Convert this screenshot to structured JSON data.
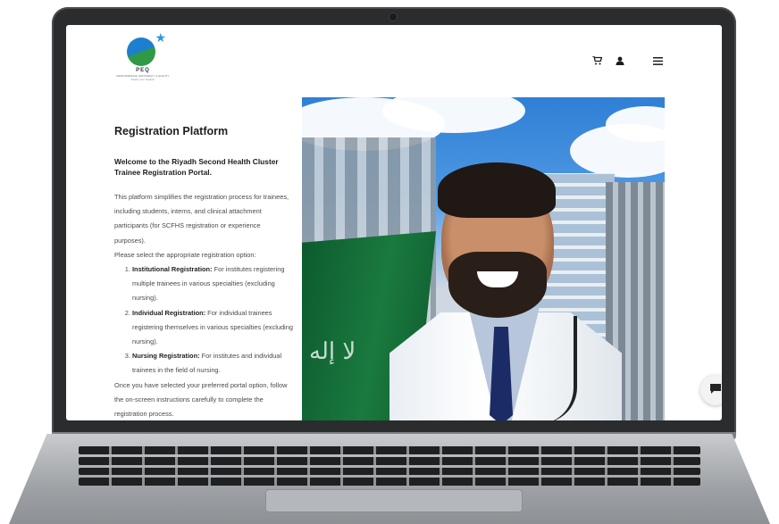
{
  "header": {
    "logo_abbr": "PEQ",
    "logo_subtitle": "PERFORMANCE, EFFICIENCY & QUALITY",
    "logo_tagline": "Reach your heights!",
    "icons": [
      "cart-icon",
      "user-icon",
      "menu-icon"
    ]
  },
  "content": {
    "title": "Registration Platform",
    "welcome": "Welcome to the Riyadh Second Health Cluster Trainee Registration Portal.",
    "intro": "This platform simplifies the registration process for trainees, including students, interns, and clinical attachment participants (for SCFHS registration or experience purposes).",
    "select_prompt": "Please select the appropriate registration option:",
    "options": [
      {
        "title": "Institutional Registration:",
        "desc": " For institutes registering multiple trainees in various specialties (excluding nursing)."
      },
      {
        "title": "Individual Registration:",
        "desc": " For individual trainees registering themselves in various specialties (excluding nursing)."
      },
      {
        "title": "Nursing Registration:",
        "desc": " For institutes and individual trainees in the field of nursing."
      }
    ],
    "closing": "Once you have selected your preferred portal option, follow the on-screen instructions carefully to complete the registration process."
  },
  "hero": {
    "flag_script": "لا إله"
  },
  "colors": {
    "accent_blue": "#1e7fd0",
    "accent_green": "#2e9a46",
    "flag_green": "#0c5a2e"
  }
}
